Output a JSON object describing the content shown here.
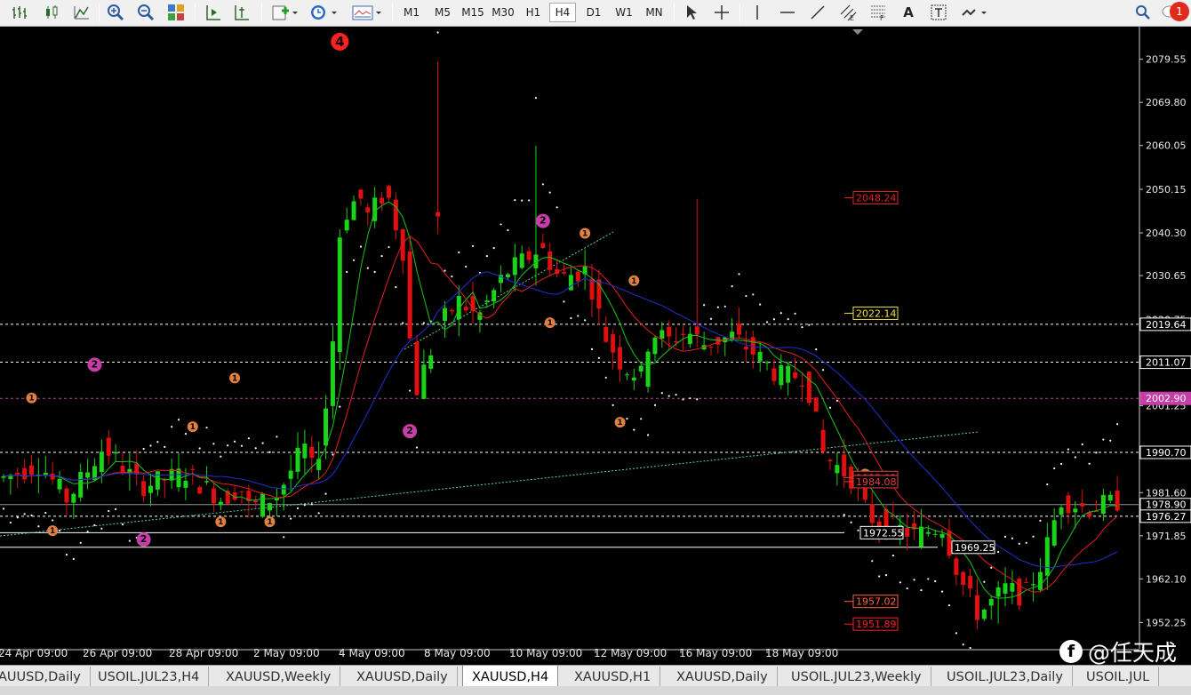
{
  "toolbar": {
    "timeframes": [
      "M1",
      "M5",
      "M15",
      "M30",
      "H1",
      "H4",
      "D1",
      "W1",
      "MN"
    ],
    "active_timeframe": "H4",
    "notification_count": "1"
  },
  "chart_data": {
    "type": "candlestick",
    "symbol": "XAUUSD",
    "timeframe": "H4",
    "y_ticks": [
      "2079.55",
      "2069.80",
      "2060.05",
      "2050.15",
      "2040.30",
      "2030.65",
      "2020.75",
      "2011.07",
      "2001.25",
      "1990.70",
      "1981.60",
      "1971.85",
      "1962.10",
      "1952.25"
    ],
    "x_ticks": [
      "24 Apr 09:00",
      "26 Apr 09:00",
      "28 Apr 09:00",
      "2 May 09:00",
      "4 May 09:00",
      "8 May 09:00",
      "10 May 09:00",
      "12 May 09:00",
      "16 May 09:00",
      "18 May 09:00"
    ],
    "axis_price_labels": [
      {
        "text": "2019.64",
        "price": 2019.64,
        "color": "#ffffff"
      },
      {
        "text": "2011.07",
        "price": 2011.07,
        "color": "#ffffff"
      },
      {
        "text": "2002.90",
        "price": 2002.9,
        "color": "#c83ea8"
      },
      {
        "text": "1990.70",
        "price": 1990.7,
        "color": "#ffffff"
      },
      {
        "text": "1978.90",
        "price": 1978.9,
        "color": "#ffffff"
      },
      {
        "text": "1976.27",
        "price": 1976.27,
        "color": "#ffffff"
      }
    ],
    "level_labels": [
      {
        "text": "2048.24",
        "price": 2048.24,
        "color": "#e02020"
      },
      {
        "text": "2022.14",
        "price": 2022.14,
        "color": "#f0e040"
      },
      {
        "text": "1985.02",
        "price": 1985.02,
        "color": "#e04040"
      },
      {
        "text": "1984.08",
        "price": 1984.08,
        "color": "#e04040"
      },
      {
        "text": "1972.55",
        "price": 1972.55,
        "color": "#ffffff"
      },
      {
        "text": "1969.25",
        "price": 1969.25,
        "color": "#ffffff"
      },
      {
        "text": "1957.02",
        "price": 1957.02,
        "color": "#ff6040"
      },
      {
        "text": "1951.89",
        "price": 1951.89,
        "color": "#ff2020"
      }
    ],
    "wave_markers": [
      {
        "label": "4",
        "price": 2083.5,
        "bar": 74,
        "color": "#ff2020"
      },
      {
        "label": "2",
        "price": 2043.0,
        "bar": 118,
        "color": "#c83ea8"
      },
      {
        "label": "2",
        "price": 2010.5,
        "bar": 20,
        "color": "#c83ea8"
      },
      {
        "label": "2",
        "price": 1995.5,
        "bar": 89,
        "color": "#c83ea8"
      },
      {
        "label": "2",
        "price": 1971.0,
        "bar": 30,
        "color": "#c83ea8"
      },
      {
        "label": "1",
        "price": 2040.2,
        "bar": 128,
        "color": "#e08040"
      },
      {
        "label": "1",
        "price": 2029.5,
        "bar": 138,
        "color": "#e08040"
      },
      {
        "label": "1",
        "price": 2020.0,
        "bar": 120,
        "color": "#e08040"
      },
      {
        "label": "1",
        "price": 2007.5,
        "bar": 50,
        "color": "#e08040"
      },
      {
        "label": "1",
        "price": 2003.0,
        "bar": 6,
        "color": "#e08040"
      },
      {
        "label": "1",
        "price": 1997.5,
        "bar": 136,
        "color": "#e08040"
      },
      {
        "label": "1",
        "price": 1996.5,
        "bar": 42,
        "color": "#e08040"
      },
      {
        "label": "1",
        "price": 1985.8,
        "bar": 189,
        "color": "#e08040"
      },
      {
        "label": "1",
        "price": 1975.0,
        "bar": 58,
        "color": "#e08040"
      },
      {
        "label": "1",
        "price": 1975.0,
        "bar": 48,
        "color": "#e08040"
      },
      {
        "label": "1",
        "price": 1973.0,
        "bar": 11,
        "color": "#e08040"
      }
    ]
  },
  "tabs": [
    "AUUSD,Daily",
    "USOIL.JUL23,H4",
    "XAUUSD,Weekly",
    "XAUUSD,Daily",
    "XAUUSD,H4",
    "XAUUSD,H1",
    "XAUUSD,Daily",
    "USOIL.JUL23,Weekly",
    "USOIL.JUL23,Daily",
    "USOIL.JUL"
  ],
  "active_tab_index": 4,
  "watermark": "@任天成"
}
